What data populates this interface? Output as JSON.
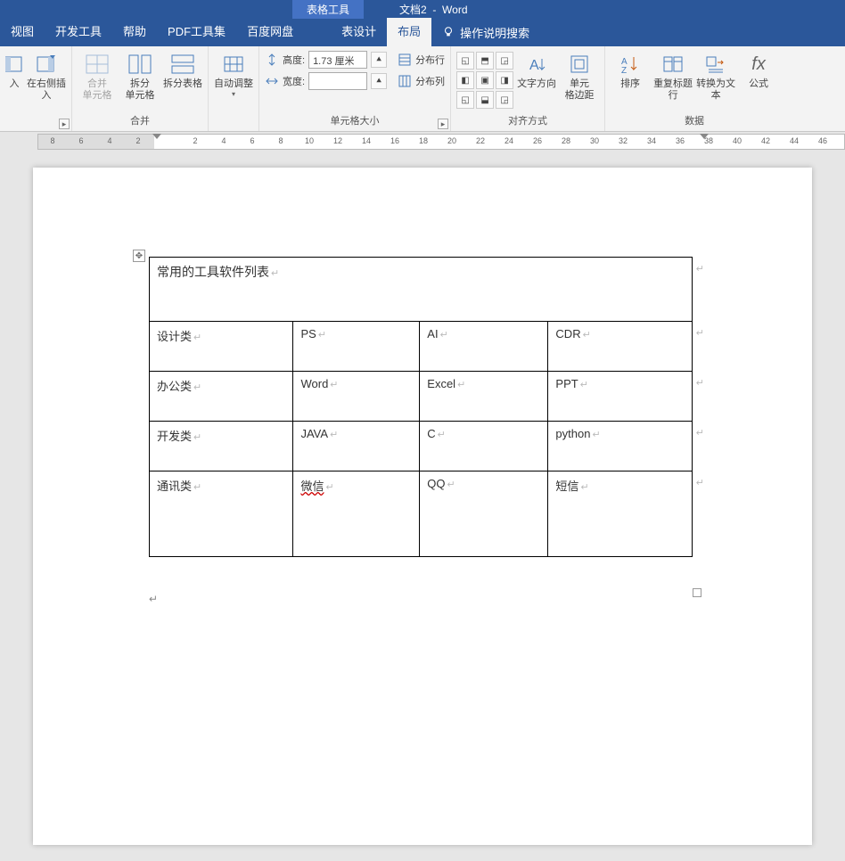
{
  "title": {
    "context": "表格工具",
    "doc": "文档2",
    "app": "Word"
  },
  "tabs": {
    "view": "视图",
    "dev": "开发工具",
    "help": "帮助",
    "pdf": "PDF工具集",
    "baidu": "百度网盘",
    "design": "表设计",
    "layout": "布局",
    "tellme": "操作说明搜索"
  },
  "ribbon": {
    "insert_right": "在右侧插入",
    "merge": {
      "merge_cells": "合并\n单元格",
      "split_cells": "拆分\n单元格",
      "split_table": "拆分表格",
      "label": "合并"
    },
    "autofit": "自动调整",
    "size": {
      "height_label": "高度:",
      "height_value": "1.73 厘米",
      "width_label": "宽度:",
      "width_value": "",
      "dist_rows": "分布行",
      "dist_cols": "分布列",
      "label": "单元格大小"
    },
    "align": {
      "text_dir": "文字方向",
      "cell_margin": "单元\n格边距",
      "label": "对齐方式"
    },
    "data": {
      "sort": "排序",
      "repeat_header": "重复标题行",
      "to_text": "转换为文本",
      "formula": "公式",
      "label": "数据"
    }
  },
  "ruler": [
    "8",
    "6",
    "4",
    "2",
    "",
    "2",
    "4",
    "6",
    "8",
    "10",
    "12",
    "14",
    "16",
    "18",
    "20",
    "22",
    "24",
    "26",
    "28",
    "30",
    "32",
    "34",
    "36",
    "38",
    "40",
    "42",
    "44",
    "46"
  ],
  "table": {
    "title": "常用的工具软件列表",
    "rows": [
      [
        "设计类",
        "PS",
        "AI",
        "CDR"
      ],
      [
        "办公类",
        "Word",
        "Excel",
        "PPT"
      ],
      [
        "开发类",
        "JAVA",
        "C",
        "python"
      ],
      [
        "通讯类",
        "微信",
        "QQ",
        "短信"
      ]
    ]
  }
}
